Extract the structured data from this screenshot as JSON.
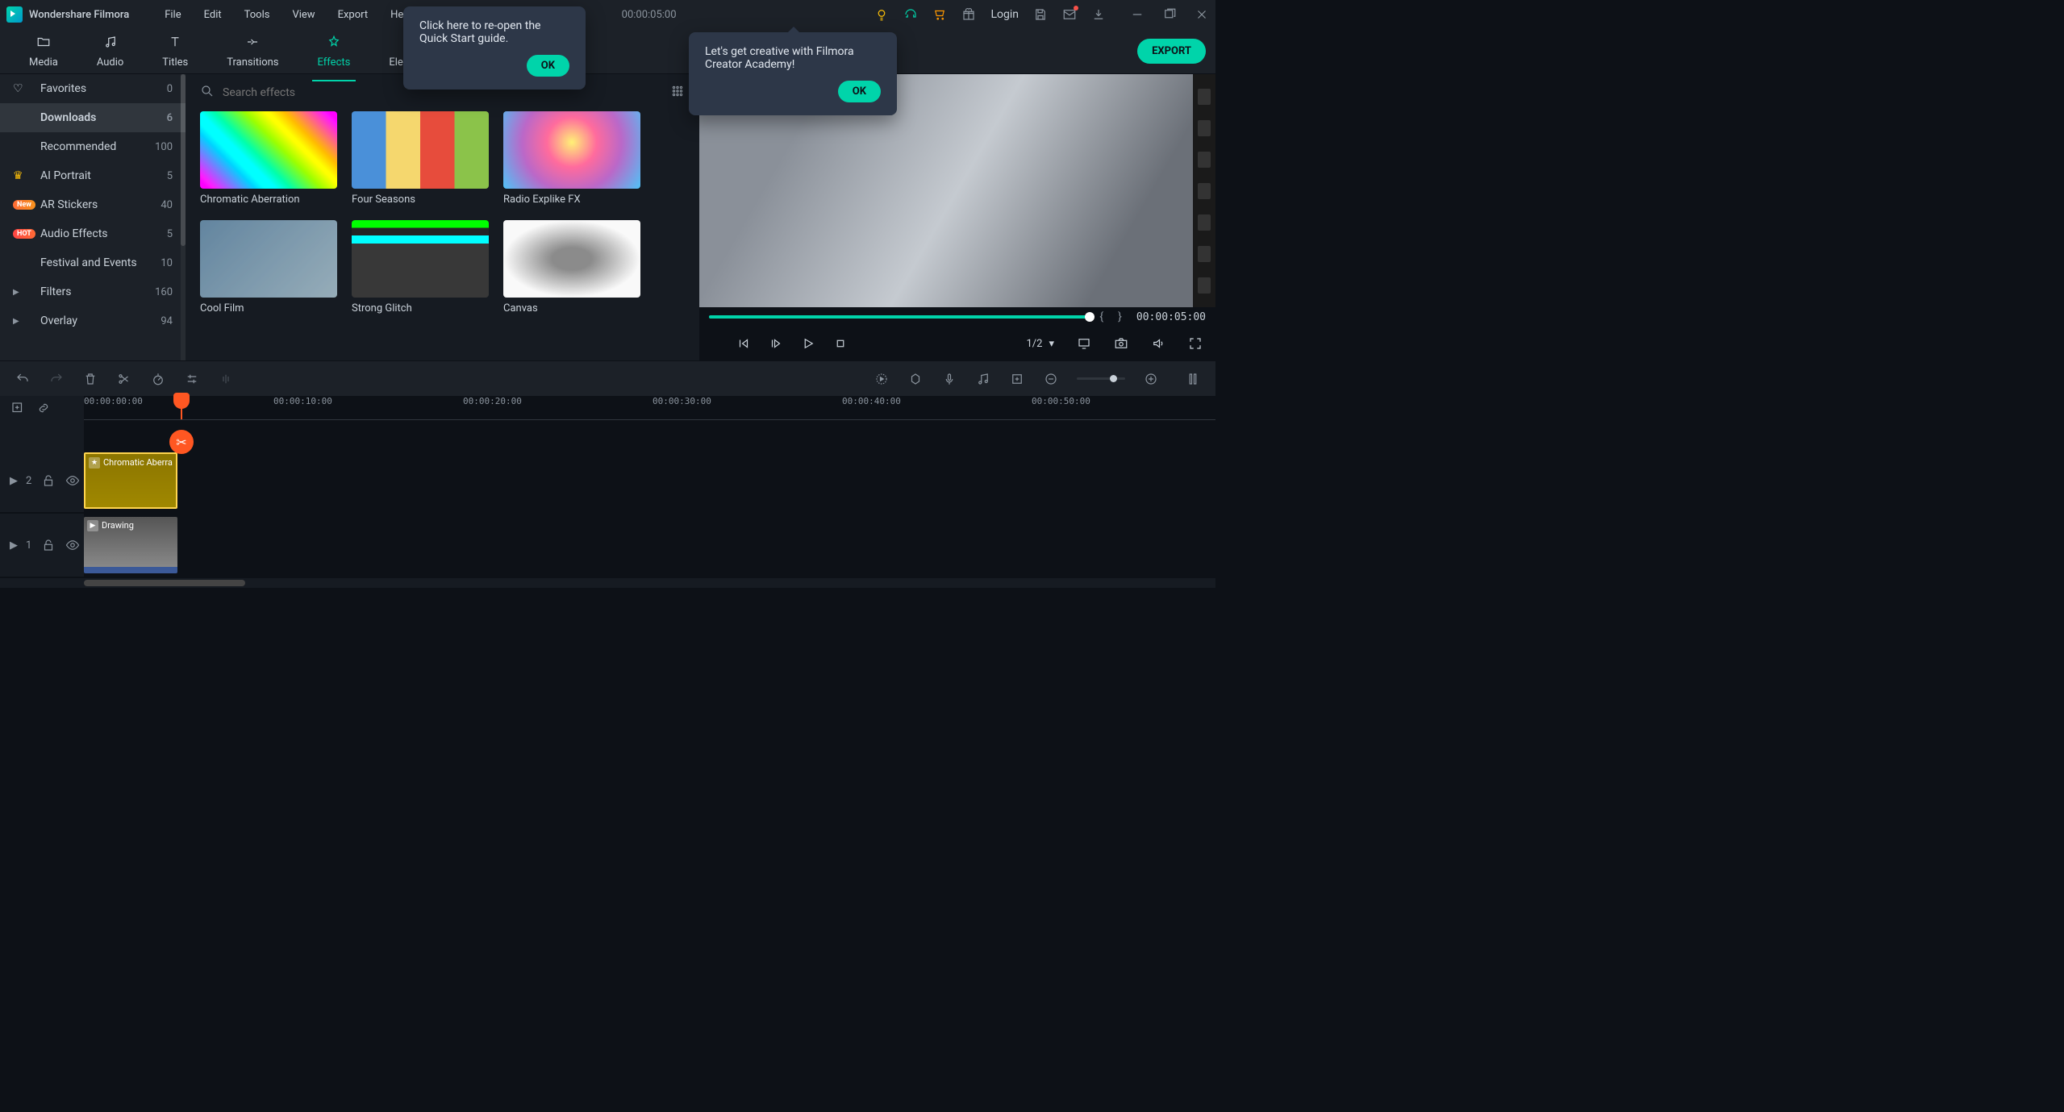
{
  "app": {
    "title": "Wondershare Filmora"
  },
  "menu": {
    "file": "File",
    "edit": "Edit",
    "tools": "Tools",
    "view": "View",
    "export": "Export",
    "help": "Help"
  },
  "titlebar": {
    "timecode": "00:00:05:00",
    "login": "Login"
  },
  "tabs": {
    "media": "Media",
    "audio": "Audio",
    "titles": "Titles",
    "transitions": "Transitions",
    "effects": "Effects",
    "elements": "Elements"
  },
  "export_btn": "EXPORT",
  "sidebar": {
    "items": [
      {
        "label": "Favorites",
        "count": "0",
        "icon": "heart"
      },
      {
        "label": "Downloads",
        "count": "6",
        "icon": ""
      },
      {
        "label": "Recommended",
        "count": "100",
        "icon": ""
      },
      {
        "label": "AI Portrait",
        "count": "5",
        "icon": "crown"
      },
      {
        "label": "AR Stickers",
        "count": "40",
        "icon": "new"
      },
      {
        "label": "Audio Effects",
        "count": "5",
        "icon": "hot"
      },
      {
        "label": "Festival and Events",
        "count": "10",
        "icon": ""
      },
      {
        "label": "Filters",
        "count": "160",
        "icon": "chev"
      },
      {
        "label": "Overlay",
        "count": "94",
        "icon": "chev"
      }
    ]
  },
  "search": {
    "placeholder": "Search effects"
  },
  "effects": [
    {
      "name": "Chromatic Aberration"
    },
    {
      "name": "Four Seasons"
    },
    {
      "name": "Radio Explike FX"
    },
    {
      "name": "Cool Film"
    },
    {
      "name": "Strong Glitch"
    },
    {
      "name": "Canvas"
    }
  ],
  "preview": {
    "time": "00:00:05:00",
    "page": "1/2"
  },
  "ruler": {
    "t0": "00:00:00:00",
    "t1": "00:00:10:00",
    "t2": "00:00:20:00",
    "t3": "00:00:30:00",
    "t4": "00:00:40:00",
    "t5": "00:00:50:00"
  },
  "tracks": {
    "fx_label": "2",
    "vid_label": "1"
  },
  "clips": {
    "effect": "Chromatic Aberra",
    "video": "Drawing"
  },
  "popups": {
    "p1": "Click here to re-open the Quick Start guide.",
    "p2": "Let's get creative with Filmora Creator Academy!",
    "ok": "OK"
  },
  "badges": {
    "new": "New",
    "hot": "HOT"
  }
}
